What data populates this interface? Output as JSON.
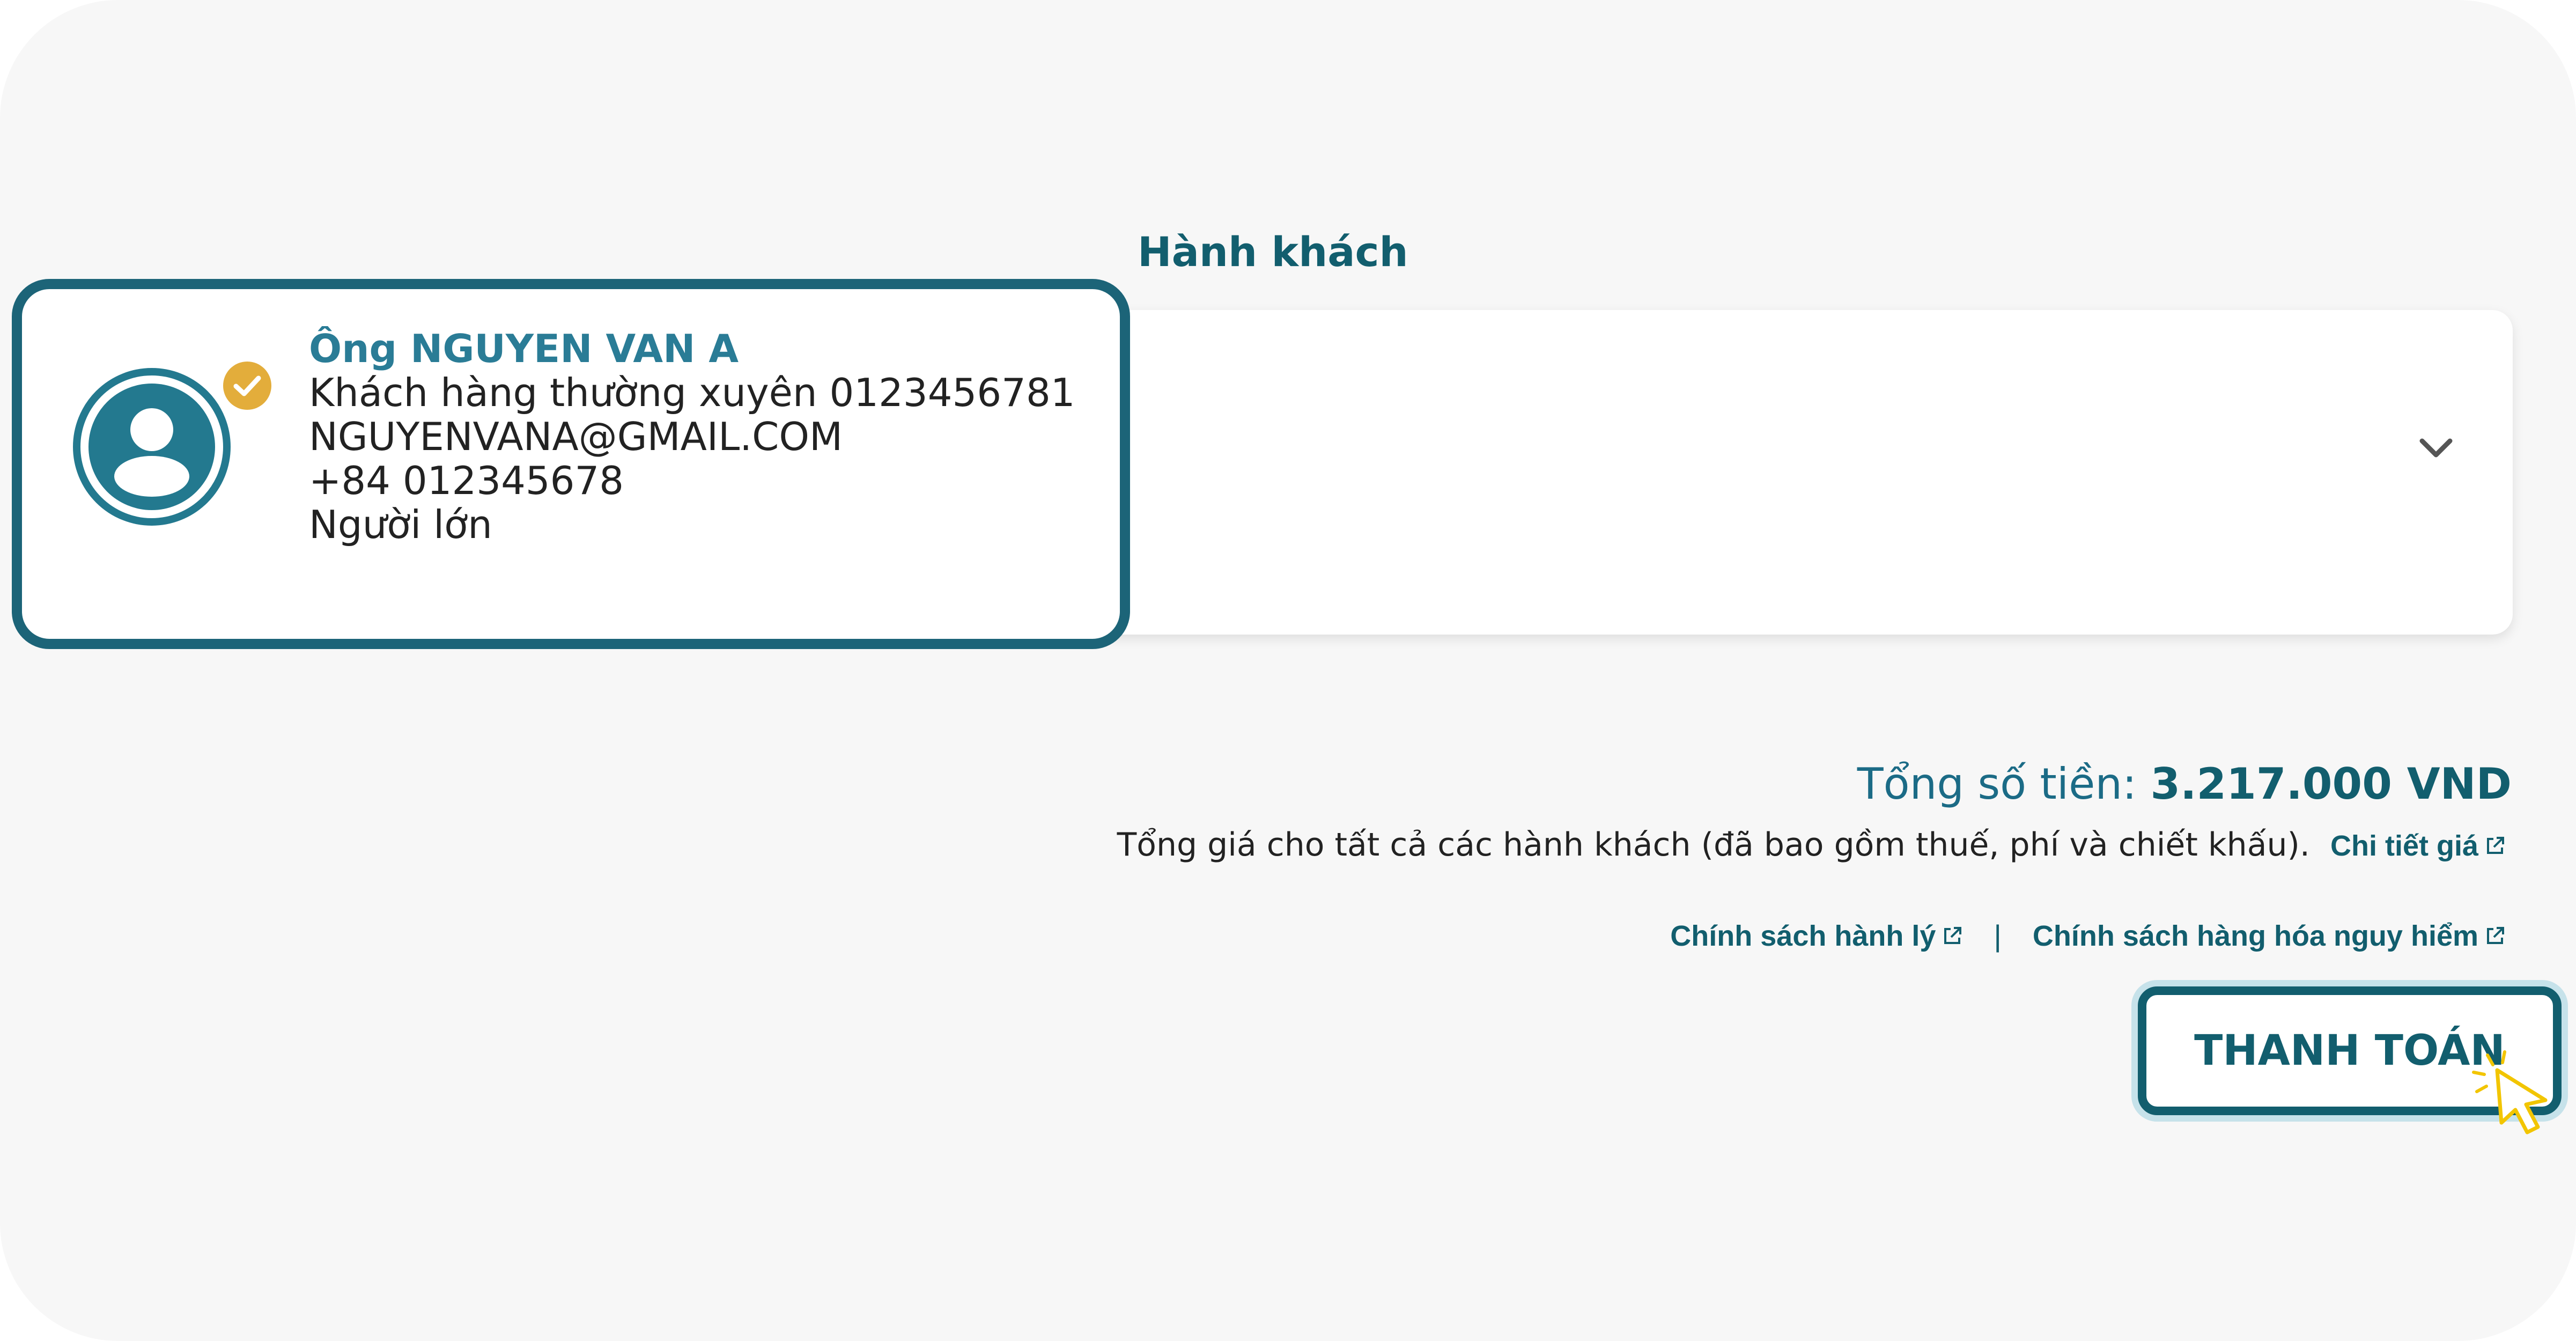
{
  "section": {
    "title": "Hành khách"
  },
  "passenger": {
    "name": "Ông NGUYEN VAN A",
    "membership": "Khách hàng thường xuyên 0123456781",
    "email": "NGUYENVANA@GMAIL.COM",
    "phone": "+84 012345678",
    "type": "Người lớn"
  },
  "summary": {
    "total_label": "Tổng số tiền:",
    "total_amount": "3.217.000 VND",
    "note": "Tổng giá cho tất cả các hành khách (đã bao gồm thuế, phí và chiết khấu).",
    "price_detail_link": "Chi tiết giá"
  },
  "policies": {
    "baggage_link": "Chính sách hành lý",
    "separator": "|",
    "dangerous_goods_link": "Chính sách hàng hóa nguy hiểm"
  },
  "actions": {
    "pay_label": "THANH TOÁN"
  },
  "icons": {
    "avatar": "user-avatar-icon",
    "verified": "check-badge-icon",
    "expand": "chevron-down-icon",
    "external_link": "external-link-icon",
    "cursor": "pointer-cursor-icon"
  },
  "colors": {
    "primary": "#125e6e",
    "accent": "#2a7c96",
    "badge": "#e3ad3b",
    "background": "#f7f7f7"
  }
}
